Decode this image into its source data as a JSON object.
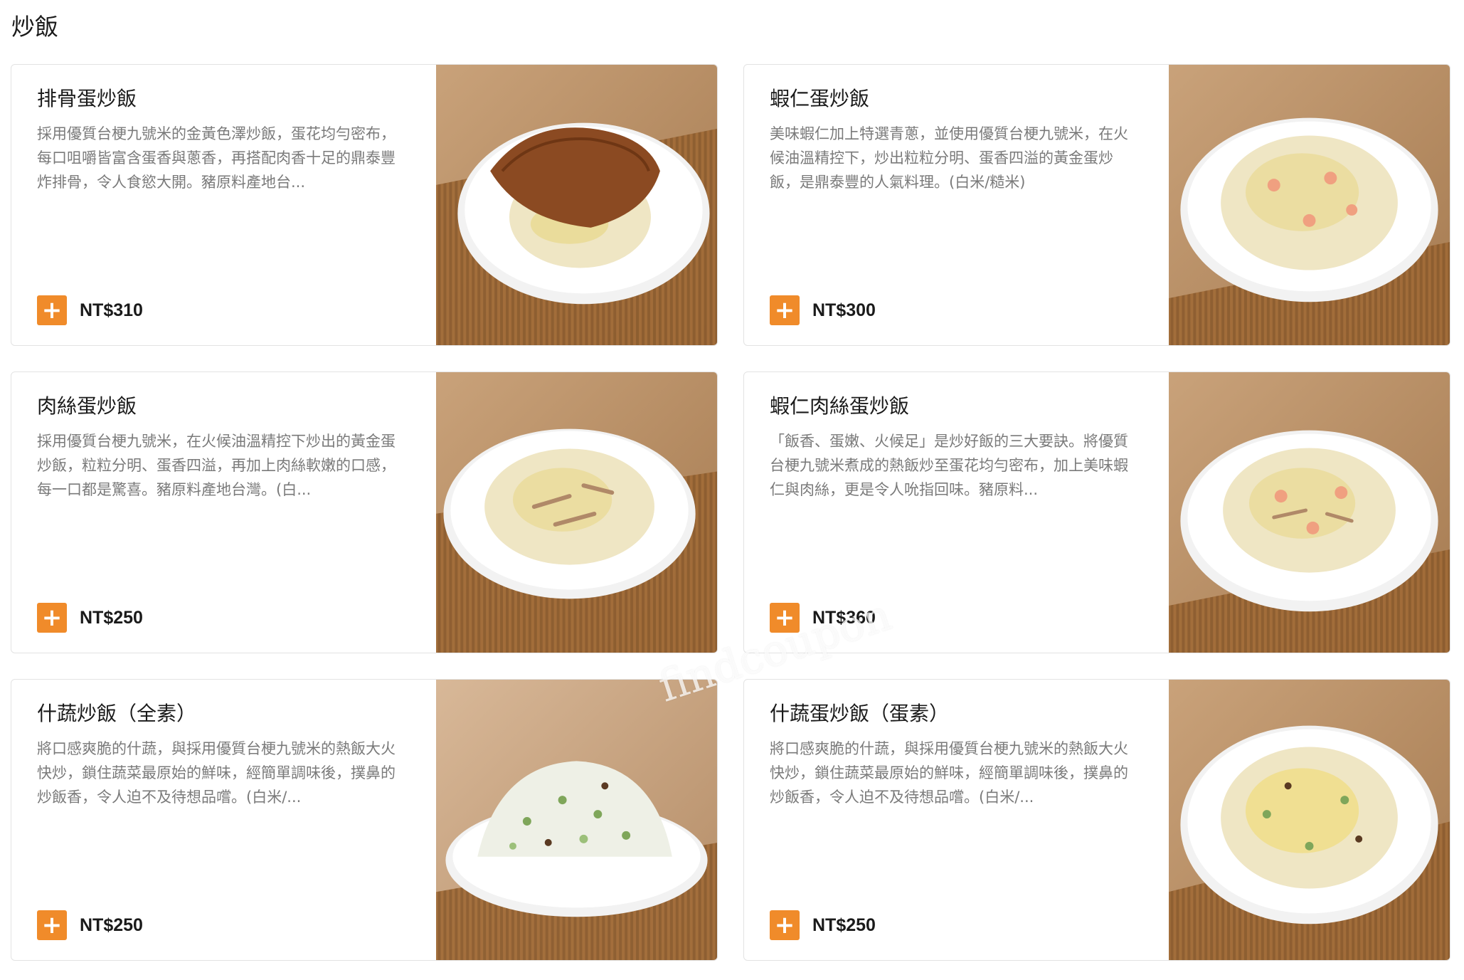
{
  "section": {
    "title": "炒飯"
  },
  "items": [
    {
      "name": "排骨蛋炒飯",
      "description": "採用優質台梗九號米的金黃色澤炒飯，蛋花均勻密布，每口咀嚼皆富含蛋香與蔥香，再搭配肉香十足的鼎泰豐炸排骨，令人食慾大開。豬原料產地台...",
      "price": "NT$310",
      "add_label": "+",
      "image_alt": "pork-chop-fried-rice"
    },
    {
      "name": "蝦仁蛋炒飯",
      "description": "美味蝦仁加上特選青蔥，並使用優質台梗九號米，在火候油溫精控下，炒出粒粒分明、蛋香四溢的黃金蛋炒飯，是鼎泰豐的人氣料理。(白米/糙米)",
      "price": "NT$300",
      "add_label": "+",
      "image_alt": "shrimp-fried-rice"
    },
    {
      "name": "肉絲蛋炒飯",
      "description": "採用優質台梗九號米，在火候油溫精控下炒出的黃金蛋炒飯，粒粒分明、蛋香四溢，再加上肉絲軟嫩的口感，每一口都是驚喜。豬原料產地台灣。(白...",
      "price": "NT$250",
      "add_label": "+",
      "image_alt": "shredded-pork-fried-rice"
    },
    {
      "name": "蝦仁肉絲蛋炒飯",
      "description": "「飯香、蛋嫩、火候足」是炒好飯的三大要訣。將優質台梗九號米煮成的熱飯炒至蛋花均勻密布，加上美味蝦仁與肉絲，更是令人吮指回味。豬原料...",
      "price": "NT$360",
      "add_label": "+",
      "image_alt": "shrimp-pork-fried-rice"
    },
    {
      "name": "什蔬炒飯（全素）",
      "description": "將口感爽脆的什蔬，與採用優質台梗九號米的熱飯大火快炒，鎖住蔬菜最原始的鮮味，經簡單調味後，撲鼻的炒飯香，令人迫不及待想品嚐。(白米/...",
      "price": "NT$250",
      "add_label": "+",
      "image_alt": "vegan-vegetable-fried-rice"
    },
    {
      "name": "什蔬蛋炒飯（蛋素）",
      "description": "將口感爽脆的什蔬，與採用優質台梗九號米的熱飯大火快炒，鎖住蔬菜最原始的鮮味，經簡單調味後，撲鼻的炒飯香，令人迫不及待想品嚐。(白米/...",
      "price": "NT$250",
      "add_label": "+",
      "image_alt": "vegetable-egg-fried-rice"
    }
  ],
  "watermark": "findcoupon",
  "colors": {
    "accent": "#f08b2a",
    "desc_text": "#7a7a7a",
    "border": "#e3e3e3"
  }
}
